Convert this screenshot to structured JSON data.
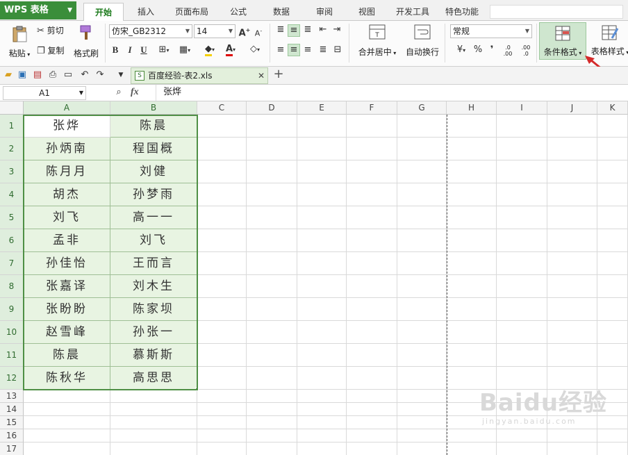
{
  "app": {
    "logo": "WPS 表格"
  },
  "menu": {
    "tabs": [
      {
        "label": "开始"
      },
      {
        "label": "插入"
      },
      {
        "label": "页面布局"
      },
      {
        "label": "公式"
      },
      {
        "label": "数据"
      },
      {
        "label": "审阅"
      },
      {
        "label": "视图"
      },
      {
        "label": "开发工具"
      },
      {
        "label": "特色功能"
      }
    ]
  },
  "ribbon": {
    "paste_label": "粘贴",
    "cut_label": "剪切",
    "copy_label": "复制",
    "format_painter_label": "格式刷",
    "font_name": "仿宋_GB2312",
    "font_size": "14",
    "bold": "B",
    "italic": "I",
    "underline": "U",
    "merge_label": "合并居中",
    "wrap_label": "自动换行",
    "number_format": "常规",
    "percent": "%",
    "comma": "❜",
    "inc_decimal": ".0 .00",
    "dec_decimal": ".00 .0",
    "cond_format_label": "条件格式",
    "table_style_label": "表格样式",
    "accent": "#3a8e3a",
    "arrow_color": "#d42a2a"
  },
  "document": {
    "tab_title": "百度经验-表2.xls",
    "add_tab": "+"
  },
  "formula_bar": {
    "cell_ref": "A1",
    "fx": "fx",
    "value": "张烨"
  },
  "grid": {
    "columns": [
      "A",
      "B",
      "C",
      "D",
      "E",
      "F",
      "G",
      "H",
      "I",
      "J",
      "K"
    ],
    "row_numbers": [
      "1",
      "2",
      "3",
      "4",
      "5",
      "6",
      "7",
      "8",
      "9",
      "10",
      "11",
      "12",
      "13",
      "14",
      "15",
      "16",
      "17"
    ],
    "rows": [
      [
        "张烨",
        "陈晨"
      ],
      [
        "孙炳南",
        "程国概"
      ],
      [
        "陈月月",
        "刘健"
      ],
      [
        "胡杰",
        "孙梦雨"
      ],
      [
        "刘飞",
        "高一一"
      ],
      [
        "孟非",
        "刘飞"
      ],
      [
        "孙佳怡",
        "王而言"
      ],
      [
        "张嘉译",
        "刘木生"
      ],
      [
        "张盼盼",
        "陈家坝"
      ],
      [
        "赵雪峰",
        "孙张一"
      ],
      [
        "陈晨",
        "慕斯斯"
      ],
      [
        "陈秋华",
        "高思思"
      ]
    ]
  },
  "watermark": {
    "brand": "Baidu经验",
    "url": "jingyan.baidu.com"
  }
}
